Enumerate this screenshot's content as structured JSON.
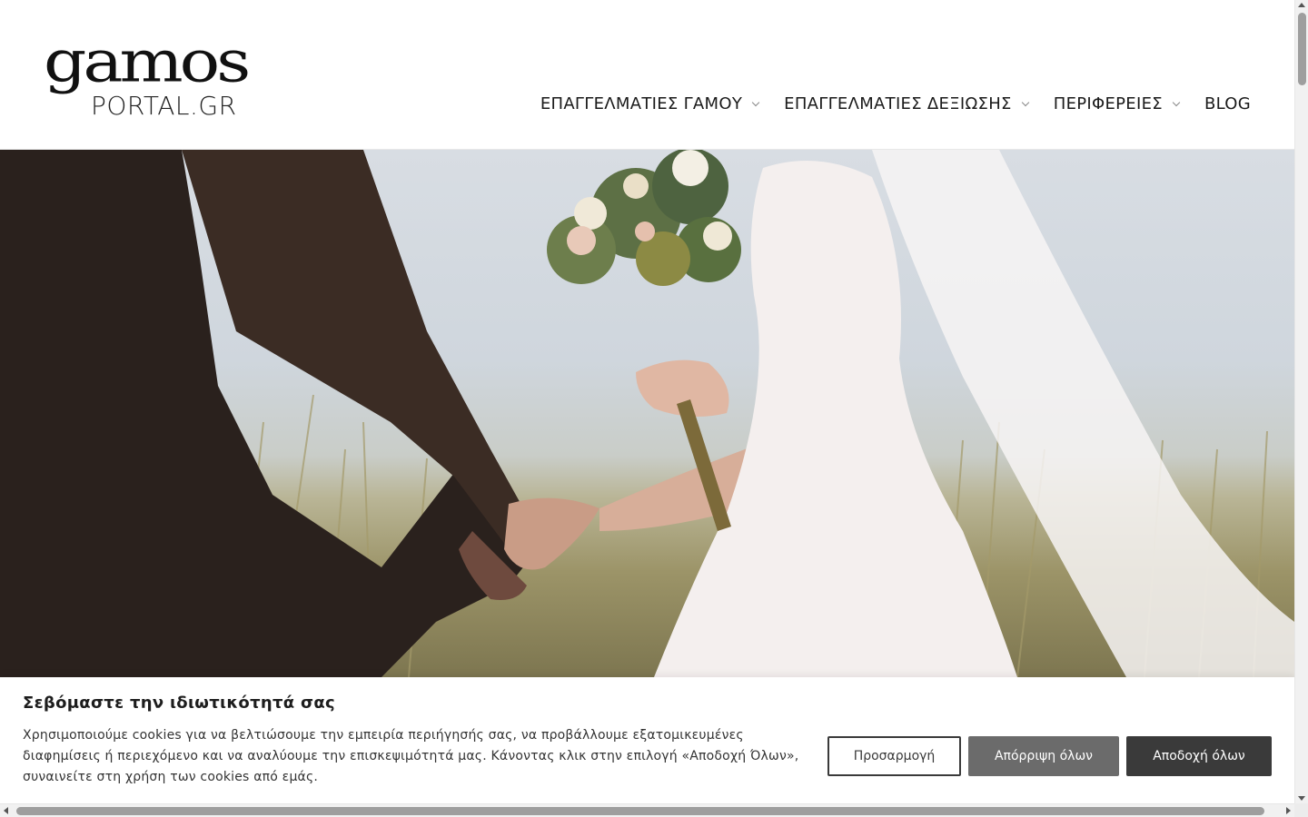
{
  "logo": {
    "top_text": "gamos",
    "bottom_text": "PORTAL.GR"
  },
  "nav": {
    "items": [
      {
        "label": "ΕΠΑΓΓΕΛΜΑΤΙΕΣ ΓΑΜΟΥ",
        "has_dropdown": true
      },
      {
        "label": "ΕΠΑΓΓΕΛΜΑΤΙΕΣ ΔΕΞΙΩΣΗΣ",
        "has_dropdown": true
      },
      {
        "label": "ΠΕΡΙΦΕΡΕΙΕΣ",
        "has_dropdown": true
      },
      {
        "label": "BLOG",
        "has_dropdown": false
      }
    ]
  },
  "hero": {
    "image_subject": "bride-and-groom-holding-hands-in-wheat-field"
  },
  "cookie_banner": {
    "title": "Σεβόμαστε την ιδιωτικότητά σας",
    "text": "Χρησιμοποιούμε cookies για να βελτιώσουμε την εμπειρία περιήγησής σας, να προβάλλουμε εξατομικευμένες διαφημίσεις ή περιεχόμενο και να αναλύουμε την επισκεψιμότητά μας. Κάνοντας κλικ στην επιλογή «Αποδοχή Όλων», συναινείτε στη χρήση των cookies από εμάς.",
    "customize_label": "Προσαρμογή",
    "reject_label": "Απόρριψη όλων",
    "accept_label": "Αποδοχή όλων"
  },
  "colors": {
    "accent_dark": "#3a3a3a",
    "reject_gray": "#6b6b6b",
    "chevron": "#8a8a8a"
  }
}
